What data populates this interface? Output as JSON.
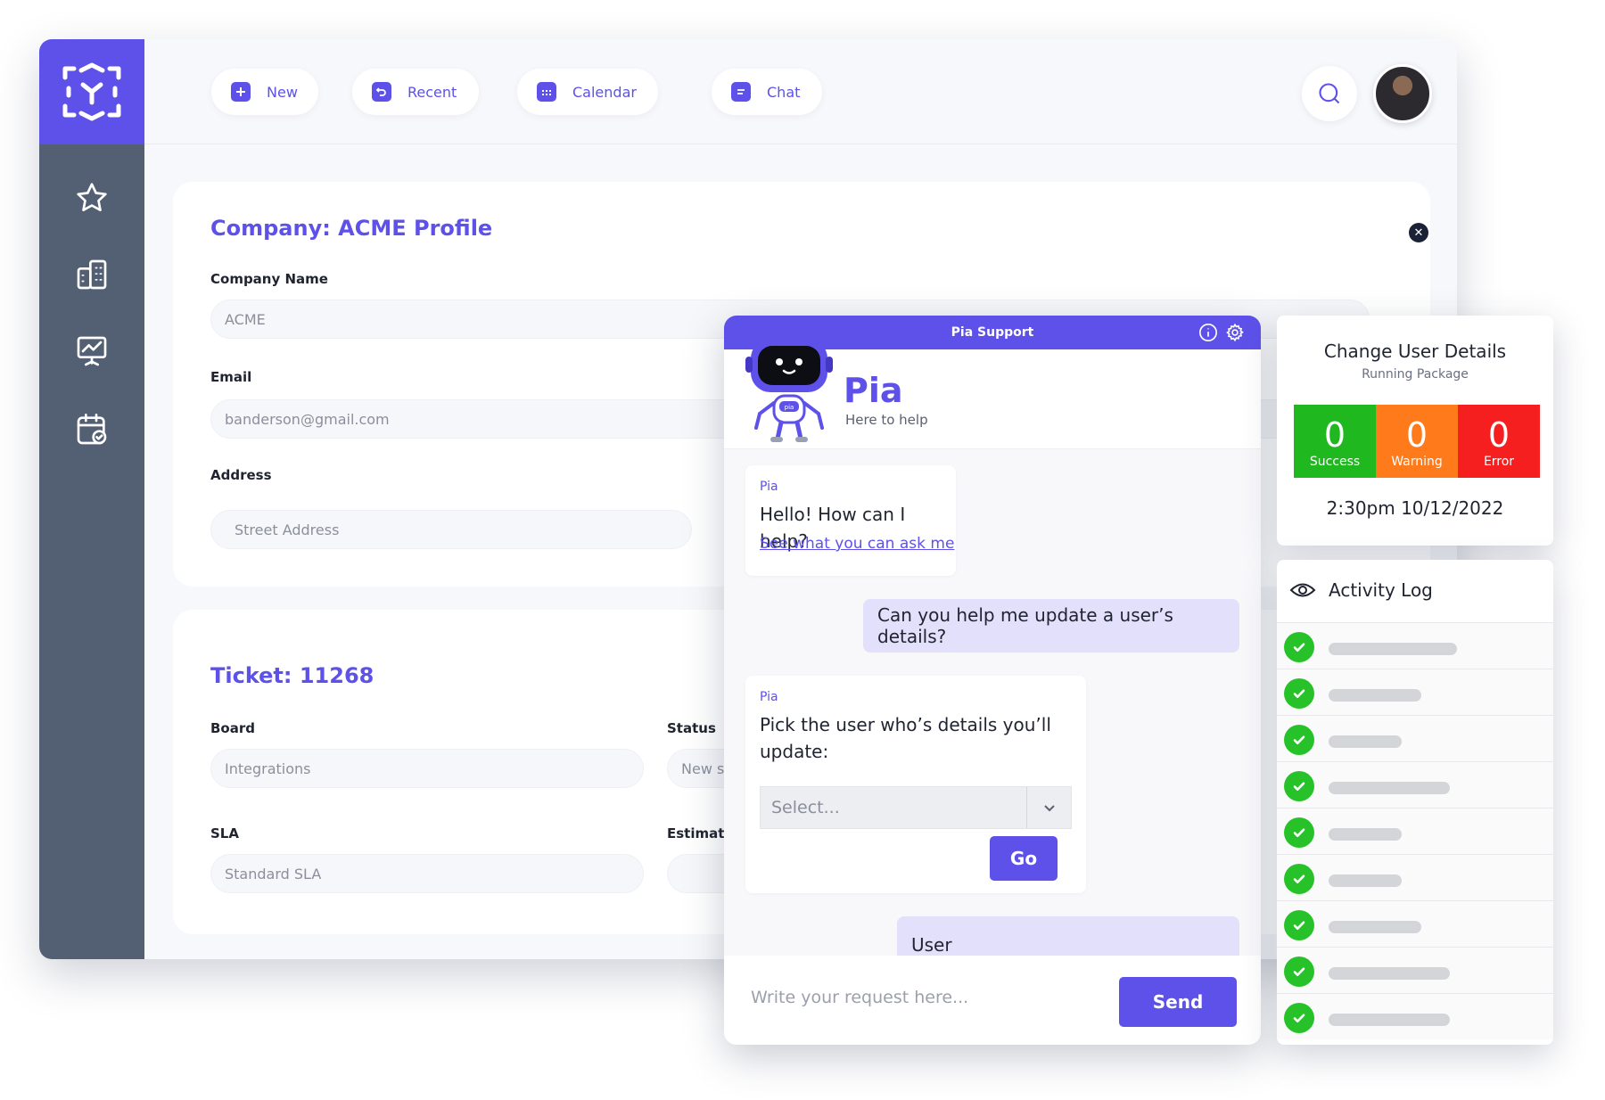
{
  "topbar": {
    "new_label": "New",
    "recent_label": "Recent",
    "calendar_label": "Calendar",
    "chat_label": "Chat"
  },
  "company": {
    "title": "Company: ACME Profile",
    "name_label": "Company Name",
    "name_value": "ACME",
    "email_label": "Email",
    "email_value": "banderson@gmail.com",
    "address_label": "Address",
    "address_placeholder": "Street Address"
  },
  "ticket": {
    "title": "Ticket: 11268",
    "board_label": "Board",
    "board_value": "Integrations",
    "status_label": "Status",
    "status_value": "New s",
    "sla_label": "SLA",
    "sla_value": "Standard SLA",
    "estimate_label": "Estimate"
  },
  "chat": {
    "header_title": "Pia Support",
    "bot_name": "Pia",
    "bot_tagline": "Here to help",
    "robot_badge": "pia",
    "messages": [
      {
        "sender": "Pia",
        "text": "Hello! How can I help?",
        "link": "See what you can ask me"
      },
      {
        "text": "Can you help me update a user’s details?"
      },
      {
        "sender": "Pia",
        "text_line1": "Pick the user who’s details you’ll",
        "text_line2": "update:",
        "select_placeholder": "Select...",
        "go_label": "Go"
      },
      {
        "text": "User"
      }
    ],
    "input_placeholder": "Write your request here...",
    "send_label": "Send"
  },
  "status_panel": {
    "title": "Change User Details",
    "subtitle": "Running Package",
    "counts": [
      {
        "value": "0",
        "label": "Success",
        "color": "#1fb81f"
      },
      {
        "value": "0",
        "label": "Warning",
        "color": "#ff7a1a"
      },
      {
        "value": "0",
        "label": "Error",
        "color": "#f51f1f"
      }
    ],
    "timestamp": "2:30pm 10/12/2022"
  },
  "activity_log": {
    "title": "Activity Log",
    "entries": 9,
    "status": "success"
  },
  "colors": {
    "brand": "#5d51ea",
    "sidebar": "#535f72",
    "success": "#27c229"
  }
}
